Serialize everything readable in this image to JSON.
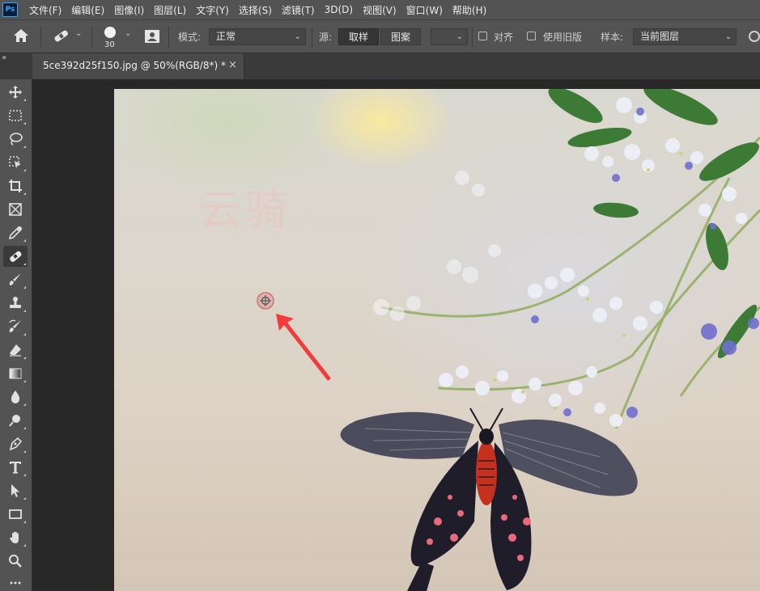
{
  "app": {
    "logo_text": "Ps"
  },
  "menu": [
    "文件(F)",
    "编辑(E)",
    "图像(I)",
    "图层(L)",
    "文字(Y)",
    "选择(S)",
    "滤镜(T)",
    "3D(D)",
    "视图(V)",
    "窗口(W)",
    "帮助(H)"
  ],
  "options_bar": {
    "brush_size": "30",
    "mode_label": "模式:",
    "mode_value": "正常",
    "source_label": "源:",
    "source_options": [
      "取样",
      "图案"
    ],
    "source_selected": "取样",
    "align_label": "对齐",
    "align_checked": false,
    "legacy_label": "使用旧版",
    "legacy_checked": false,
    "sample_label": "样本:",
    "sample_value": "当前图层"
  },
  "document": {
    "tab_title": "5ce392d25f150.jpg @ 50%(RGB/8*) *",
    "close_glyph": "×"
  },
  "tools": [
    {
      "name": "move-tool-icon"
    },
    {
      "name": "marquee-tool-icon"
    },
    {
      "name": "lasso-tool-icon"
    },
    {
      "name": "object-select-tool-icon"
    },
    {
      "name": "crop-tool-icon"
    },
    {
      "name": "frame-tool-icon"
    },
    {
      "name": "eyedropper-tool-icon"
    },
    {
      "name": "healing-brush-tool-icon",
      "active": true
    },
    {
      "name": "brush-tool-icon"
    },
    {
      "name": "clone-stamp-tool-icon"
    },
    {
      "name": "history-brush-tool-icon"
    },
    {
      "name": "eraser-tool-icon"
    },
    {
      "name": "gradient-tool-icon"
    },
    {
      "name": "blur-tool-icon"
    },
    {
      "name": "dodge-tool-icon"
    },
    {
      "name": "pen-tool-icon"
    },
    {
      "name": "type-tool-icon"
    },
    {
      "name": "path-select-tool-icon"
    },
    {
      "name": "rectangle-tool-icon"
    },
    {
      "name": "hand-tool-icon"
    },
    {
      "name": "zoom-tool-icon"
    }
  ],
  "canvas": {
    "watermark_text": "云骑"
  },
  "colors": {
    "accent": "#31a8ff",
    "arrow": "#f23c3c",
    "panel": "#535353",
    "canvas_bg": "#282828"
  }
}
